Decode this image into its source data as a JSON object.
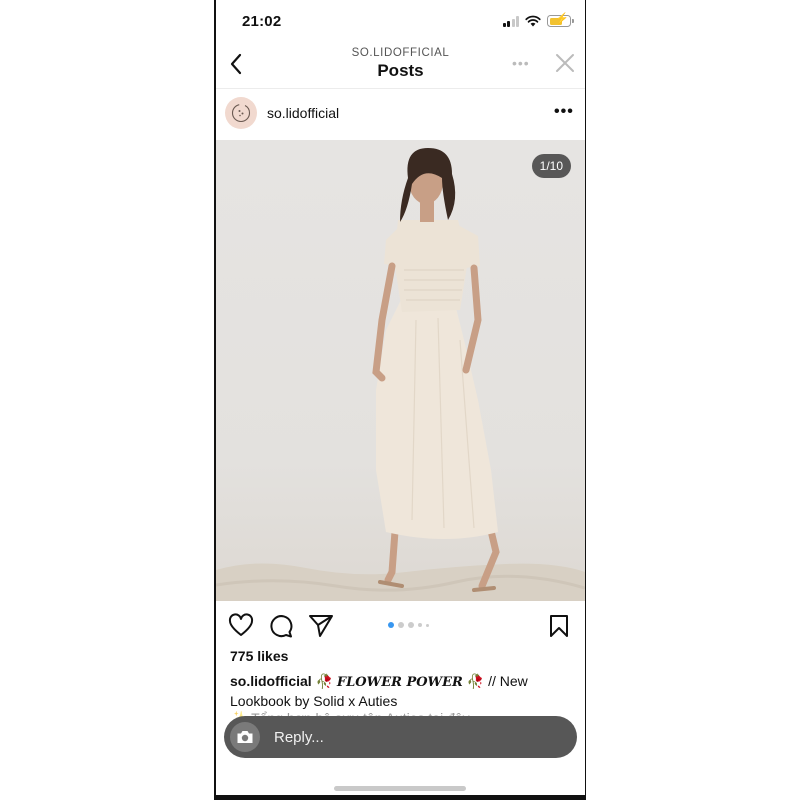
{
  "status_bar": {
    "time": "21:02",
    "signal_icon": "cellular-signal-icon",
    "wifi_icon": "wifi-icon",
    "battery_icon": "battery-charging-icon",
    "battery_color": "#f2c230"
  },
  "header": {
    "subtitle": "SO.LIDOFFICIAL",
    "title": "Posts",
    "back_icon": "chevron-left-icon",
    "more_icon": "ellipsis-icon",
    "close_icon": "close-icon"
  },
  "post": {
    "username": "so.lidofficial",
    "avatar_icon": "brand-logo-avatar",
    "more_icon": "ellipsis-icon",
    "image_counter": "1/10",
    "image_description": "model-in-cream-dress-photo",
    "carousel": {
      "total_dots_visible": 5,
      "active_index": 0,
      "active_color": "#3897f0"
    },
    "actions": {
      "like_icon": "heart-icon",
      "comment_icon": "comment-icon",
      "share_icon": "send-icon",
      "save_icon": "bookmark-icon"
    },
    "likes": "775 likes",
    "caption": {
      "user": "so.lidofficial",
      "emoji": "🥀",
      "highlight": "FLOWER POWER",
      "text_after": " // New",
      "line2": "Lookbook by Solid x Auties",
      "line3_partial": "✨ Tổng hợp bộ sưu tập Auties tại đây…"
    }
  },
  "reply_bar": {
    "camera_icon": "camera-icon",
    "placeholder": "Reply..."
  }
}
